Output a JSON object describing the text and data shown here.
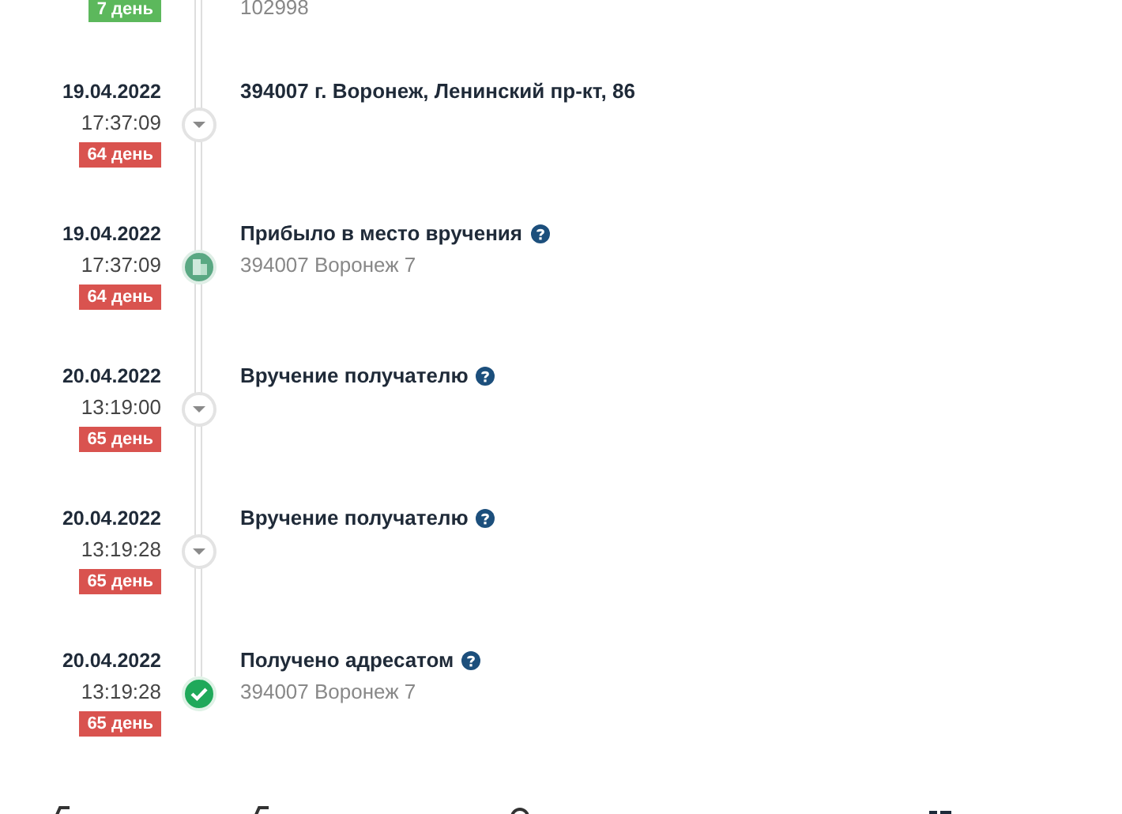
{
  "first": {
    "badge": {
      "text": "7 день",
      "color": "#5cb85c"
    },
    "subtitle": "102998"
  },
  "events": [
    {
      "date": "19.04.2022",
      "time": "17:37:09",
      "badge": {
        "text": "64 день",
        "color": "#d9534f"
      },
      "title": "394007 г. Воронеж, Ленинский пр-кт, 86",
      "help": false,
      "kind": "arrow"
    },
    {
      "date": "19.04.2022",
      "time": "17:37:09",
      "badge": {
        "text": "64 день",
        "color": "#d9534f"
      },
      "title": "Прибыло в место вручения",
      "help": true,
      "subtitle": "394007 Воронеж 7",
      "kind": "building"
    },
    {
      "date": "20.04.2022",
      "time": "13:19:00",
      "badge": {
        "text": "65 день",
        "color": "#d9534f"
      },
      "title": "Вручение получателю",
      "help": true,
      "kind": "arrow"
    },
    {
      "date": "20.04.2022",
      "time": "13:19:28",
      "badge": {
        "text": "65 день",
        "color": "#d9534f"
      },
      "title": "Вручение получателю",
      "help": true,
      "kind": "arrow"
    },
    {
      "date": "20.04.2022",
      "time": "13:19:28",
      "badge": {
        "text": "65 день",
        "color": "#d9534f"
      },
      "title": "Получено адресатом",
      "help": true,
      "subtitle": "394007 Воронеж 7",
      "kind": "check"
    }
  ]
}
